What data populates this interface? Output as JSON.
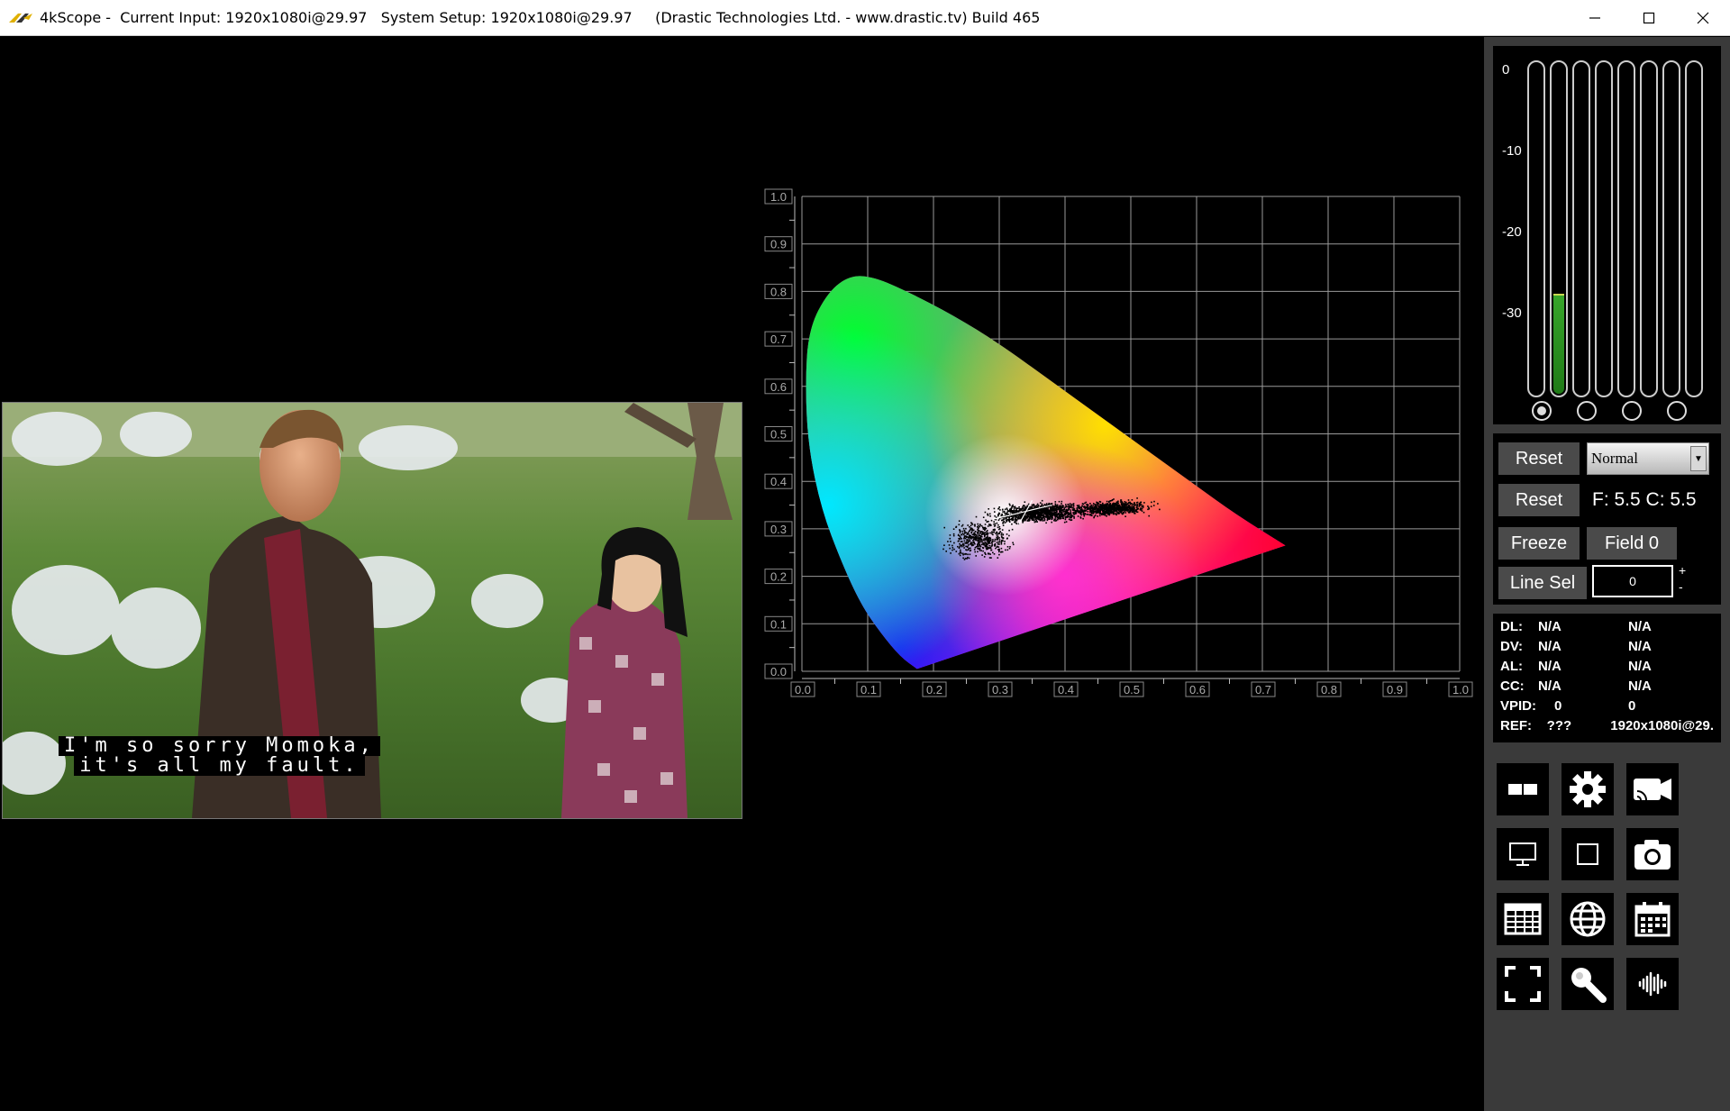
{
  "titlebar": {
    "text": "4kScope -  Current Input: 1920x1080i@29.97   System Setup: 1920x1080i@29.97     (Drastic Technologies Ltd. - www.drastic.tv) Build 465"
  },
  "video": {
    "subtitle_line1": "I'm so sorry Momoka,",
    "subtitle_line2": "it's all my fault."
  },
  "chart_data": {
    "type": "scatter",
    "title": "",
    "xlabel": "",
    "ylabel": "",
    "xlim": [
      0.0,
      1.0
    ],
    "ylim": [
      0.0,
      1.0
    ],
    "grid": true,
    "x_ticks": [
      "0.0",
      "0.1",
      "0.2",
      "0.3",
      "0.4",
      "0.5",
      "0.6",
      "0.7",
      "0.8",
      "0.9",
      "1.0"
    ],
    "y_ticks": [
      "0.0",
      "0.1",
      "0.2",
      "0.3",
      "0.4",
      "0.5",
      "0.6",
      "0.7",
      "0.8",
      "0.9",
      "1.0"
    ],
    "locus": [
      [
        0.175,
        0.005
      ],
      [
        0.15,
        0.03
      ],
      [
        0.12,
        0.08
      ],
      [
        0.09,
        0.14
      ],
      [
        0.06,
        0.23
      ],
      [
        0.03,
        0.34
      ],
      [
        0.01,
        0.47
      ],
      [
        0.005,
        0.6
      ],
      [
        0.01,
        0.72
      ],
      [
        0.04,
        0.8
      ],
      [
        0.074,
        0.834
      ],
      [
        0.11,
        0.83
      ],
      [
        0.16,
        0.8
      ],
      [
        0.23,
        0.75
      ],
      [
        0.3,
        0.69
      ],
      [
        0.38,
        0.61
      ],
      [
        0.45,
        0.54
      ],
      [
        0.52,
        0.47
      ],
      [
        0.6,
        0.39
      ],
      [
        0.66,
        0.33
      ],
      [
        0.735,
        0.265
      ]
    ],
    "point_cloud": [
      {
        "x": 0.36,
        "y": 0.335,
        "spread_x": 0.09,
        "spread_y": 0.025,
        "weight": 0.5
      },
      {
        "x": 0.47,
        "y": 0.345,
        "spread_x": 0.07,
        "spread_y": 0.02,
        "weight": 0.3
      },
      {
        "x": 0.27,
        "y": 0.28,
        "spread_x": 0.06,
        "spread_y": 0.05,
        "weight": 0.2
      }
    ]
  },
  "meters": {
    "scale": [
      "0",
      "-10",
      "-20",
      "-30"
    ],
    "range_db": [
      -40,
      0
    ],
    "levels_db": [
      -40,
      -28,
      -40,
      -40,
      -40,
      -40,
      -40,
      -40
    ],
    "selected_radio": 0
  },
  "controls": {
    "reset1": "Reset",
    "mode": "Normal",
    "reset2": "Reset",
    "fc": "F: 5.5  C: 5.5",
    "freeze": "Freeze",
    "field": "Field 0",
    "linesel": "Line Sel",
    "line_value": "0",
    "plus": "+",
    "minus": "-"
  },
  "status": {
    "rows": [
      {
        "label": "DL:",
        "v1": "N/A",
        "v2": "N/A"
      },
      {
        "label": "DV:",
        "v1": "N/A",
        "v2": "N/A"
      },
      {
        "label": "AL:",
        "v1": "N/A",
        "v2": "N/A"
      },
      {
        "label": "CC:",
        "v1": "N/A",
        "v2": "N/A"
      },
      {
        "label": "VPID:",
        "v1": "0",
        "v2": "0"
      },
      {
        "label": "REF:",
        "v1": "???",
        "v2": "1920x1080i@29."
      }
    ]
  },
  "colors": {
    "meter_green": "#37a52a",
    "sidebar_bg": "#3a3a3a",
    "button_bg": "#4a4a4a"
  }
}
